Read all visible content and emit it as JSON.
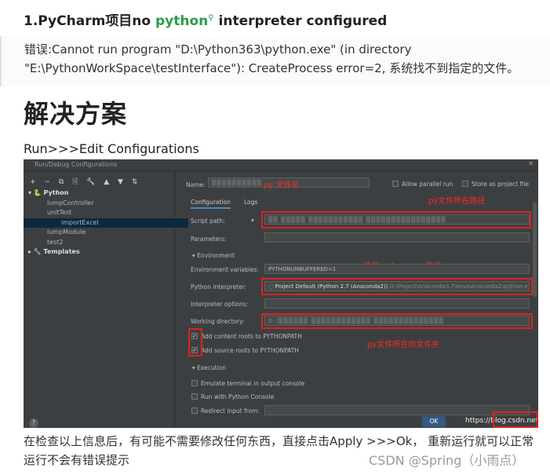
{
  "heading": {
    "prefix": "1.PyCharm项目no ",
    "keyword": "python",
    "suffix": " interpreter configured"
  },
  "error_quote": {
    "line1": "错误:Cannot run program \"D:\\Python363\\python.exe\" (in directory",
    "line2": "\"E:\\PythonWorkSpace\\testInterface\"): CreateProcess error=2, 系统找不到指定的文件。"
  },
  "solution_title": "解决方案",
  "menu_path": "Run>>>Edit Configurations",
  "dialog": {
    "title": "Run/Debug Configurations",
    "toolbar_icons": "+ − ⧉ 🗎 🔧 ▲ ▼ ⇅",
    "tree": {
      "python_group": "Python",
      "items": [
        "lumpController",
        "unitTest",
        "importExcel",
        "lumpModule",
        "test2"
      ],
      "selected_index": 2,
      "templates": "Templates"
    },
    "name_label": "Name:",
    "name_annotation": ".py 文件名",
    "allow_parallel": "Allow parallel run",
    "store_as_project": "Store as project file",
    "tabs": [
      "Configuration",
      "Logs"
    ],
    "script_path_label": "Script path:",
    "script_annotation": ".py文件所在路径",
    "parameters_label": "Parameters:",
    "environment_section": "Environment",
    "env_vars_label": "Environment variables:",
    "env_vars_value": "PYTHONUNBUFFERED=1",
    "interpreter_annotation": "使用python.exe 路径",
    "python_interpreter_label": "Python interpreter:",
    "python_interpreter_value": "Project Default (Python 2.7 (Anaconda2))",
    "python_interpreter_path": "D:\\Project\\Anaconda3.7\\envs\\Anaconda2\\python.e",
    "interpreter_options_label": "Interpreter options:",
    "working_dir_label": "Working directory:",
    "working_dir_annotation": ".py文件所在的文件夹",
    "add_content_roots": "Add content roots to PYTHONPATH",
    "add_source_roots": "Add source roots to PYTHONPATH",
    "execution_section": "Execution",
    "emulate_terminal": "Emulate terminal in output console",
    "run_with_console": "Run with Python Console",
    "redirect_input": "Redirect input from:",
    "ok_label": "OK",
    "help_label": "?",
    "watermark": "https://blog.csdn.net/Jmila"
  },
  "footer_text": "在检查以上信息后，有可能不需要修改任何东西，直接点击Apply >>>Ok， 重新运行就可以正常运行不会有错误提示",
  "csdn_watermark": "CSDN @Spring（小雨点）",
  "colors": {
    "accent_green": "#2a9d4a",
    "annotation_red": "#ff2a1f",
    "ide_background": "#3c3f41"
  }
}
